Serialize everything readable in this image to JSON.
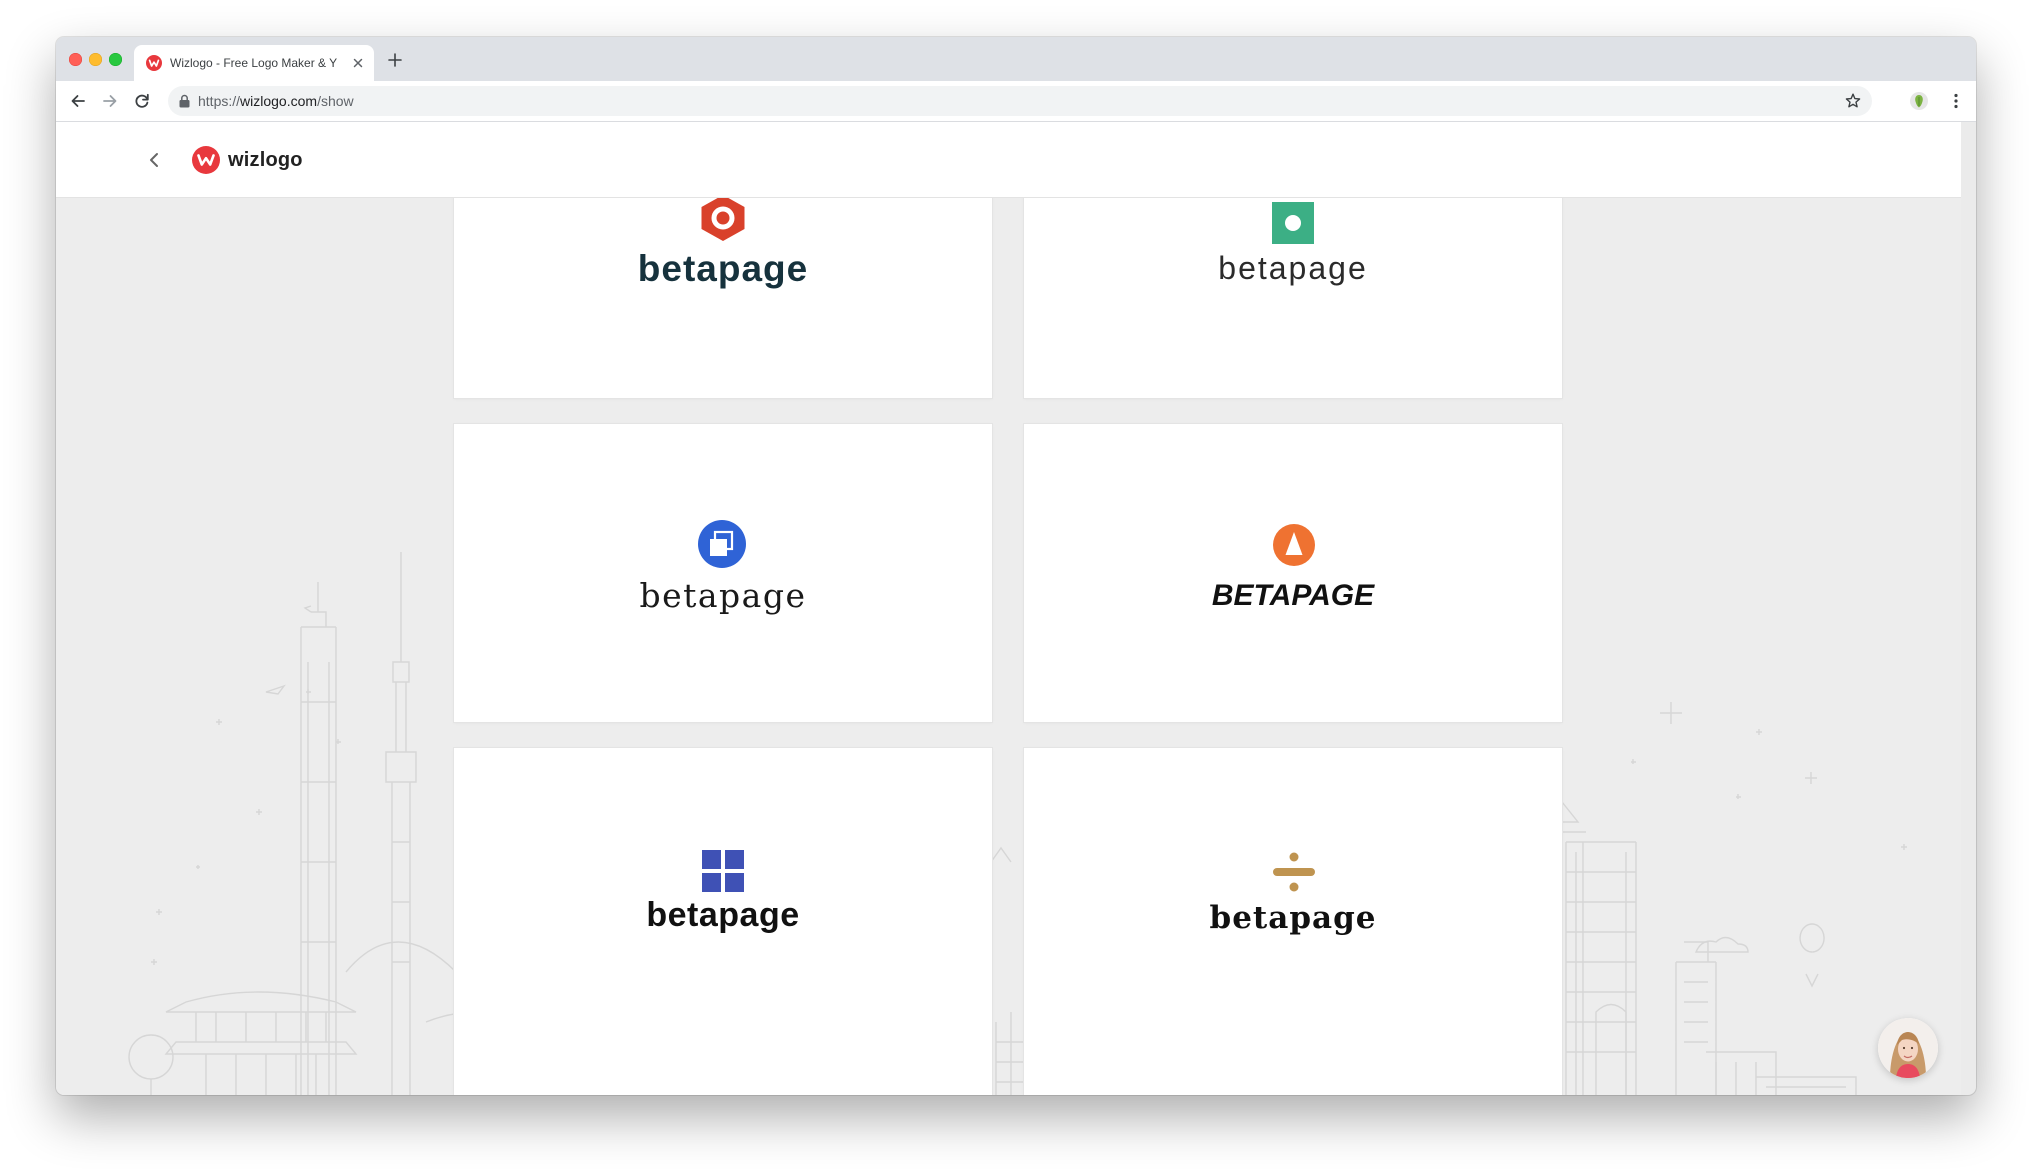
{
  "browser": {
    "tab_title": "Wizlogo - Free Logo Maker & Y",
    "url_scheme": "https://",
    "url_host": "wizlogo.com",
    "url_path": "/show"
  },
  "site": {
    "brand_name": "wizlogo"
  },
  "logos": [
    {
      "text": "betapage",
      "icon": "hexagon-ring-icon",
      "color": "#d9412b",
      "text_color": "#16323d"
    },
    {
      "text": "betapage",
      "icon": "square-dot-icon",
      "color": "#3caf85",
      "text_color": "#2b2b2b"
    },
    {
      "text": "betapage",
      "icon": "overlapping-squares-circle-icon",
      "color": "#2f63d6",
      "text_color": "#1a1a1a"
    },
    {
      "text": "BETAPAGE",
      "icon": "triangle-in-circle-icon",
      "color": "#ef7231",
      "text_color": "#111111"
    },
    {
      "text": "betapage",
      "icon": "four-squares-grid-icon",
      "color": "#3f51b5",
      "text_color": "#111111"
    },
    {
      "text": "betapage",
      "icon": "divide-sign-icon",
      "color": "#bf9450",
      "text_color": "#111111"
    }
  ]
}
